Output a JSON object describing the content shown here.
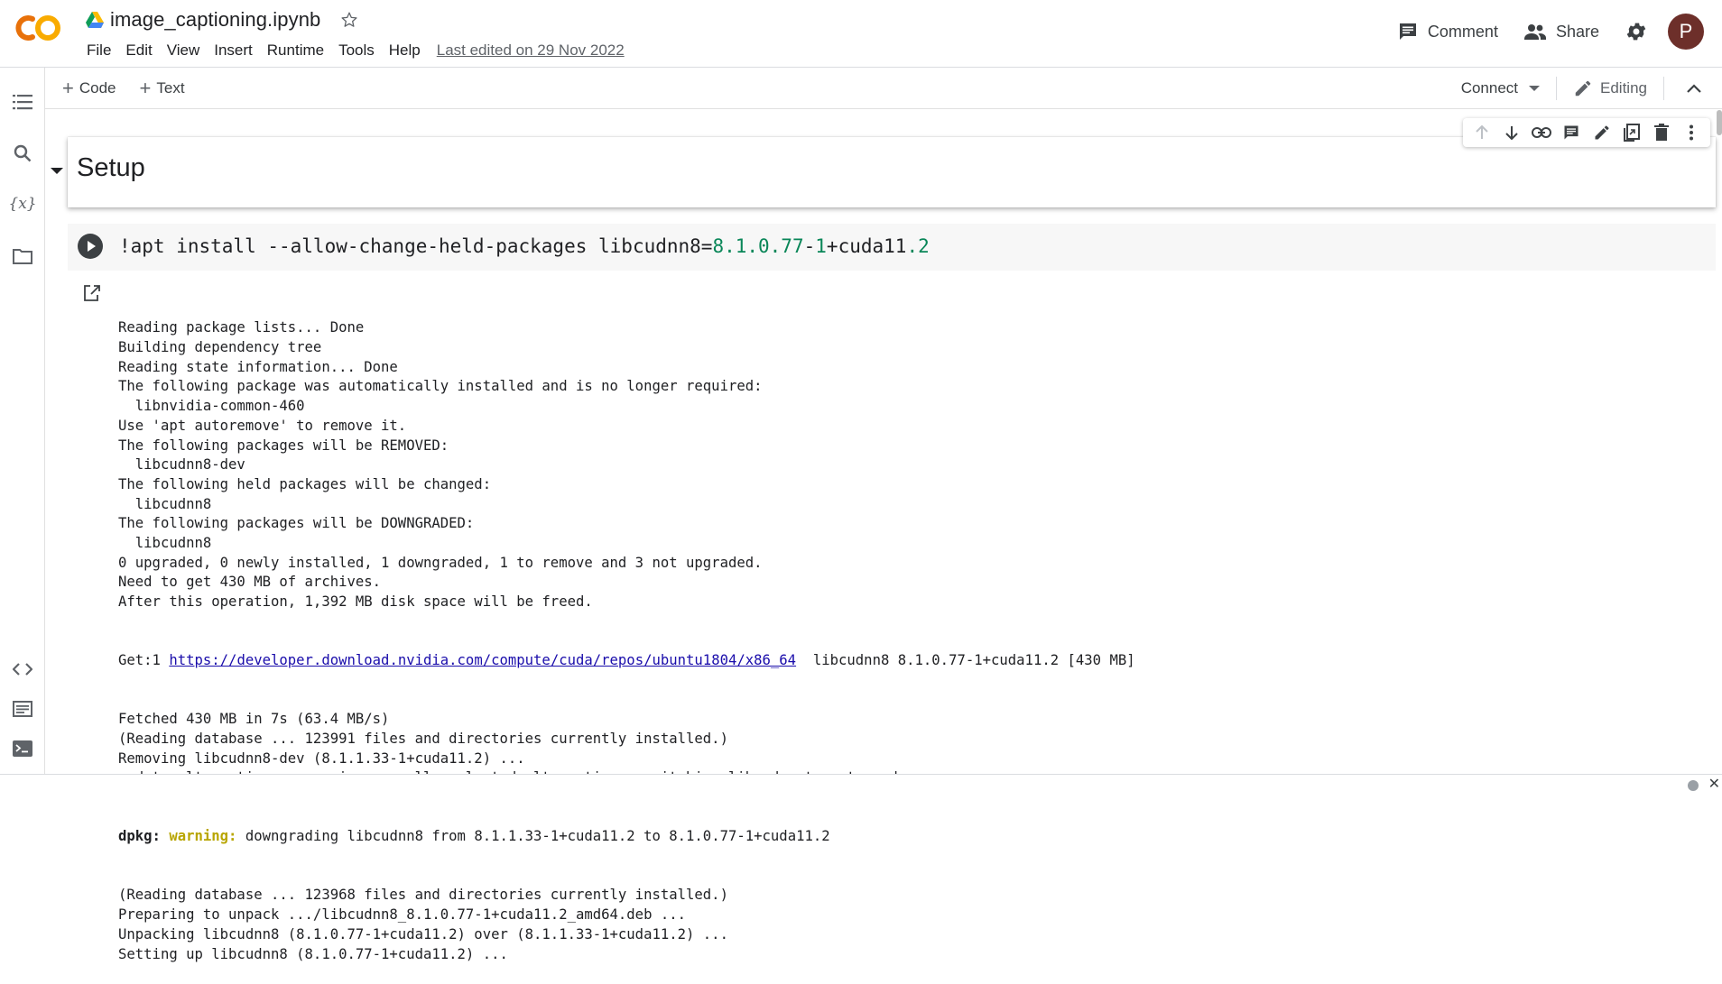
{
  "header": {
    "title": "image_captioning.ipynb",
    "menu": [
      "File",
      "Edit",
      "View",
      "Insert",
      "Runtime",
      "Tools",
      "Help"
    ],
    "last_edited": "Last edited on 29 Nov 2022",
    "comment_label": "Comment",
    "share_label": "Share",
    "avatar_letter": "P"
  },
  "toolbar": {
    "add_code": "Code",
    "add_text": "Text",
    "connect": "Connect",
    "editing": "Editing"
  },
  "cells": {
    "section_title": "Setup",
    "code": {
      "prefix": "!apt install --allow-change-held-packages libcudnn8=",
      "ver1": "8.1.0.77",
      "dash": "-",
      "ver1b": "1",
      "plus": "+cuda11",
      "ver2": ".2"
    },
    "output": {
      "lines_a": [
        "Reading package lists... Done",
        "Building dependency tree",
        "Reading state information... Done",
        "The following package was automatically installed and is no longer required:",
        "  libnvidia-common-460",
        "Use 'apt autoremove' to remove it.",
        "The following packages will be REMOVED:",
        "  libcudnn8-dev",
        "The following held packages will be changed:",
        "  libcudnn8",
        "The following packages will be DOWNGRADED:",
        "  libcudnn8",
        "0 upgraded, 0 newly installed, 1 downgraded, 1 to remove and 3 not upgraded.",
        "Need to get 430 MB of archives.",
        "After this operation, 1,392 MB disk space will be freed."
      ],
      "get_prefix": "Get:1 ",
      "get_link": "https://developer.download.nvidia.com/compute/cuda/repos/ubuntu1804/x86_64",
      "get_suffix": "  libcudnn8 8.1.0.77-1+cuda11.2 [430 MB]",
      "lines_b": [
        "Fetched 430 MB in 7s (63.4 MB/s)",
        "(Reading database ... 123991 files and directories currently installed.)",
        "Removing libcudnn8-dev (8.1.1.33-1+cuda11.2) ...",
        "update-alternatives: removing manually selected alternative - switching libcudnn to auto mode"
      ],
      "warn_label": "dpkg:",
      "warn_word": "warning:",
      "warn_text": " downgrading libcudnn8 from 8.1.1.33-1+cuda11.2 to 8.1.0.77-1+cuda11.2",
      "lines_c": [
        "(Reading database ... 123968 files and directories currently installed.)",
        "Preparing to unpack .../libcudnn8_8.1.0.77-1+cuda11.2_amd64.deb ...",
        "Unpacking libcudnn8 (8.1.0.77-1+cuda11.2) over (8.1.1.33-1+cuda11.2) ...",
        "Setting up libcudnn8 (8.1.0.77-1+cuda11.2) ..."
      ]
    }
  },
  "bottom": {
    "close_glyph": "✕"
  },
  "colors": {
    "accent_orange": "#F9AB00",
    "logo_orange": "#E8710A",
    "number_green": "#098658",
    "link_blue": "#1a0dab",
    "warning_yellow": "#b8a500",
    "avatar": "#6d2f2a"
  },
  "icons": [
    "colab-logo",
    "drive-icon",
    "star-icon",
    "comment-icon",
    "share-icon",
    "gear-icon",
    "toc-icon",
    "search-icon",
    "variables-icon",
    "folder-icon",
    "code-snippets-icon",
    "command-palette-icon",
    "terminal-icon",
    "run-icon",
    "output-icon"
  ]
}
